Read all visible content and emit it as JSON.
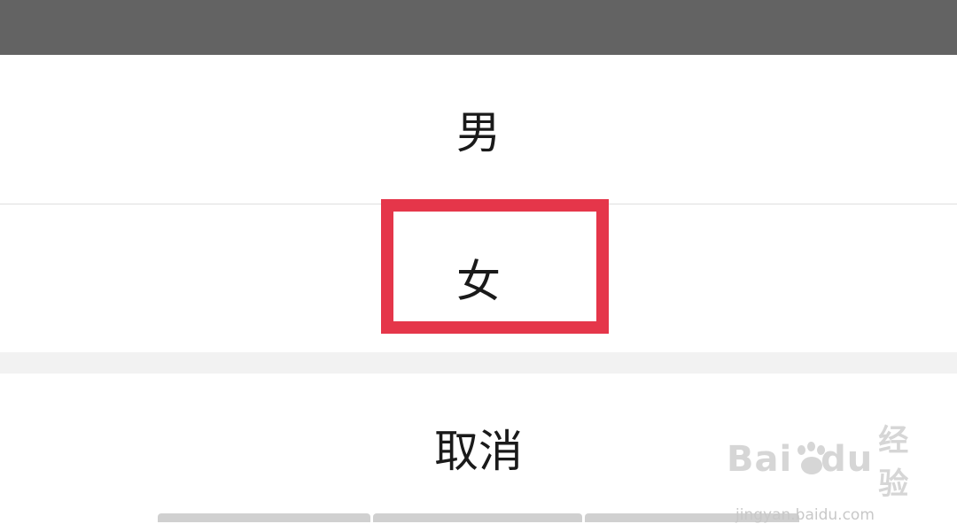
{
  "dialog": {
    "options": [
      {
        "label": "男"
      },
      {
        "label": "女"
      }
    ],
    "cancel_label": "取消",
    "highlight_color": "#e5364a"
  },
  "watermark": {
    "brand_left": "Bai",
    "brand_right": "du",
    "brand_cn": "经验",
    "url": "jingyan.baidu.com"
  }
}
